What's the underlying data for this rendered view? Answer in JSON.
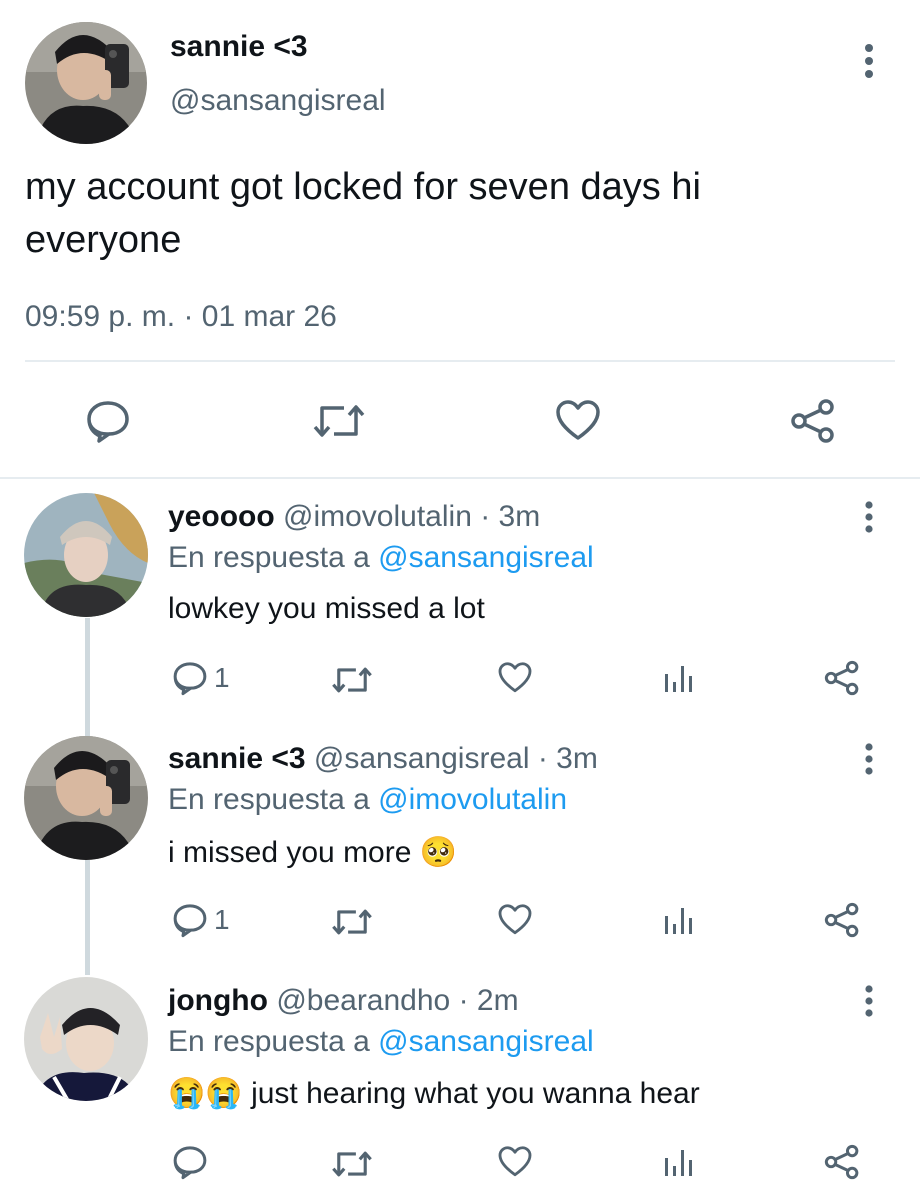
{
  "main_tweet": {
    "display_name": "sannie <3",
    "handle": "@sansangisreal",
    "text_line1": "my account got locked for seven days hi",
    "text_line2": "everyone",
    "time": "09:59 p. m.",
    "separator": "·",
    "date": "01 mar 26",
    "actions": [
      "reply-icon",
      "retweet-icon",
      "like-icon",
      "share-icon"
    ]
  },
  "replies": [
    {
      "display_name": "yeoooo",
      "handle": "@imovolutalin",
      "time": "· 3m",
      "reply_prefix": "En respuesta a",
      "reply_to": "@sansangisreal",
      "text": "lowkey you missed a lot",
      "reply_count": "1"
    },
    {
      "display_name": "sannie <3",
      "handle": "@sansangisreal",
      "time": "· 3m",
      "reply_prefix": "En respuesta a",
      "reply_to": "@imovolutalin",
      "text": "i missed you more",
      "emoji": "🥺",
      "reply_count": "1"
    },
    {
      "display_name": "jongho",
      "handle": "@bearandho",
      "time": "· 2m",
      "reply_prefix": "En respuesta a",
      "reply_to": "@sansangisreal",
      "emoji": "😭😭",
      "text": "just hearing what you wanna hear",
      "reply_count": ""
    }
  ],
  "colors": {
    "text": "#0f1419",
    "muted": "#536471",
    "link": "#1d9bf0",
    "divider": "#e6ecf0",
    "thread_line": "#cfd9de"
  }
}
